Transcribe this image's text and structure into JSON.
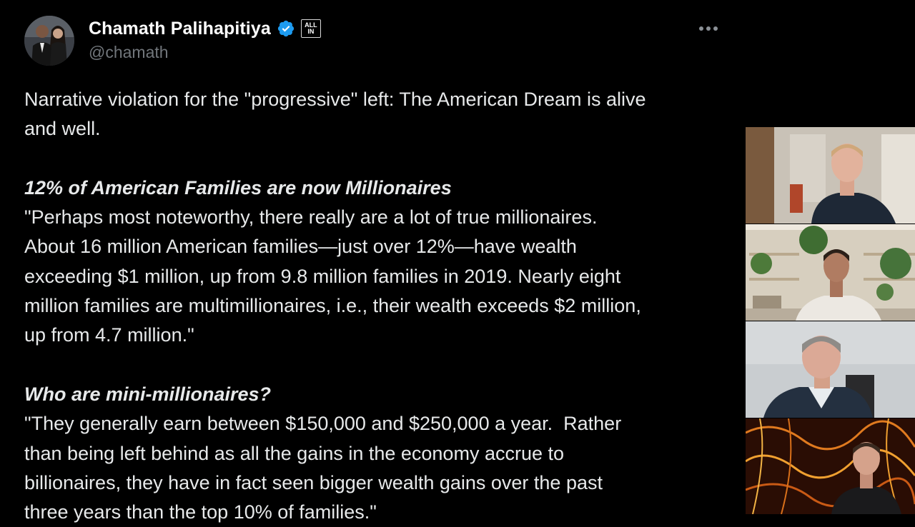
{
  "author": {
    "name": "Chamath Palihapitiya",
    "handle": "@chamath",
    "badge_top": "ALL",
    "badge_bottom": "IN"
  },
  "icons": {
    "verified": "verified-badge-icon",
    "more": "more-options-icon"
  },
  "colors": {
    "background": "#000000",
    "text": "#e7e9ea",
    "muted": "#71767b",
    "verified_blue": "#1d9bf0"
  },
  "tweet": {
    "intro": "Narrative violation for the \"progressive\" left: The American Dream is alive\nand well.",
    "heading1": "12% of American Families are now Millionaires",
    "quote1": "\"Perhaps most noteworthy, there really are a lot of true millionaires.\nAbout 16 million American families—just over 12%—have wealth\nexceeding $1 million, up from 9.8 million families in 2019. Nearly eight\nmillion families are multimillionaires, i.e., their wealth exceeds $2 million,\nup from 4.7 million.\"",
    "heading2": "Who are mini-millionaires?",
    "quote2": "\"They generally earn between $150,000 and $250,000 a year.  Rather\nthan being left behind as all the gains in the economy accrue to\nbillionaires, they have in fact seen bigger wealth gains over the past\nthree years than the top 10% of families.\""
  },
  "video_tiles": [
    {
      "participant": "participant-1"
    },
    {
      "participant": "participant-2"
    },
    {
      "participant": "participant-3"
    },
    {
      "participant": "participant-4"
    }
  ]
}
